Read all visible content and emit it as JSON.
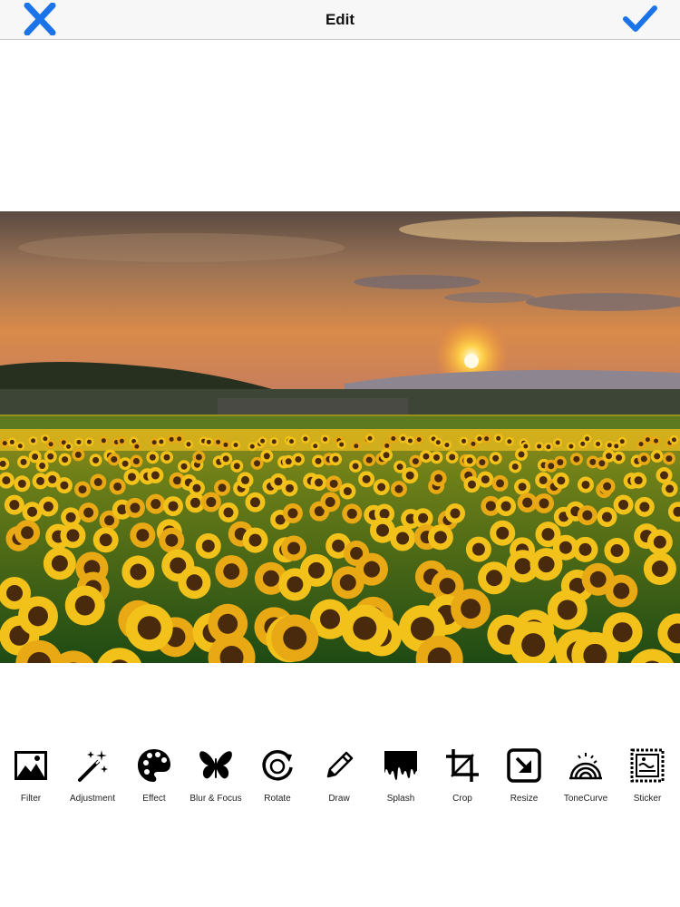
{
  "header": {
    "title": "Edit",
    "close_icon": "close-x-icon",
    "done_icon": "checkmark-icon",
    "accent_color": "#1a73e8"
  },
  "photo": {
    "description_hidden": false
  },
  "toolbar": {
    "items": [
      {
        "label": "Filter",
        "icon": "filter-icon"
      },
      {
        "label": "Adjustment",
        "icon": "magic-wand-icon"
      },
      {
        "label": "Effect",
        "icon": "palette-icon"
      },
      {
        "label": "Blur & Focus",
        "icon": "butterfly-icon"
      },
      {
        "label": "Rotate",
        "icon": "rotate-icon"
      },
      {
        "label": "Draw",
        "icon": "pencil-icon"
      },
      {
        "label": "Splash",
        "icon": "splash-icon"
      },
      {
        "label": "Crop",
        "icon": "crop-icon"
      },
      {
        "label": "Resize",
        "icon": "resize-icon"
      },
      {
        "label": "ToneCurve",
        "icon": "tone-curve-icon"
      },
      {
        "label": "Sticker",
        "icon": "sticker-icon"
      }
    ]
  }
}
